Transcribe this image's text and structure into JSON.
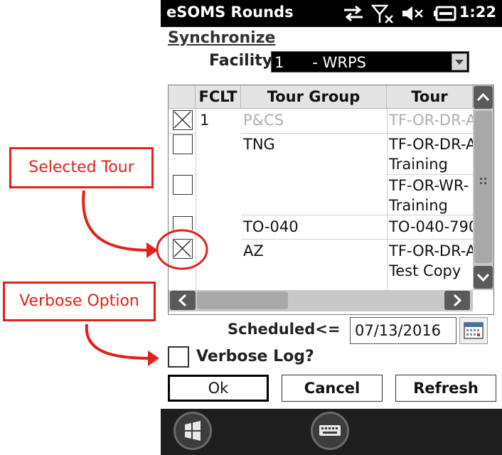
{
  "status_bar": {
    "app_title": "eSOMS Rounds",
    "time": "1:22",
    "icons": [
      "sync-arrows-icon",
      "no-signal-icon",
      "volume-muted-icon",
      "battery-charging-icon"
    ]
  },
  "form": {
    "title": "Synchronize",
    "facility_label": "Facility",
    "facility_value": "1      - WRPS"
  },
  "grid": {
    "columns": [
      "FCLT",
      "Tour Group",
      "Tour"
    ],
    "rows": [
      {
        "checked": true,
        "fclt": "1",
        "group": "P&CS",
        "tour": "TF-OR-DR-A",
        "tour2": "",
        "dim": true
      },
      {
        "checked": false,
        "fclt": "",
        "group": "TNG",
        "tour": "TF-OR-DR-A",
        "tour2": "Training",
        "dim": false
      },
      {
        "checked": false,
        "fclt": "",
        "group": "",
        "tour": "TF-OR-WR-",
        "tour2": "Training",
        "dim": false
      },
      {
        "checked": false,
        "fclt": "",
        "group": "TO-040",
        "tour": "TO-040-790",
        "tour2": "",
        "dim": false
      },
      {
        "checked": true,
        "fclt": "",
        "group": "AZ",
        "tour": "TF-OR-DR-A",
        "tour2": "Test Copy",
        "dim": false
      }
    ]
  },
  "schedule": {
    "label": "Scheduled<=",
    "date": "07/13/2016"
  },
  "verbose": {
    "label": "Verbose Log?",
    "checked": false
  },
  "buttons": {
    "ok": "Ok",
    "cancel": "Cancel",
    "refresh": "Refresh"
  },
  "callouts": {
    "selected_tour": "Selected Tour",
    "verbose_option": "Verbose Option"
  },
  "colors": {
    "callout": "#e3211a",
    "status_bar": "#000000"
  }
}
